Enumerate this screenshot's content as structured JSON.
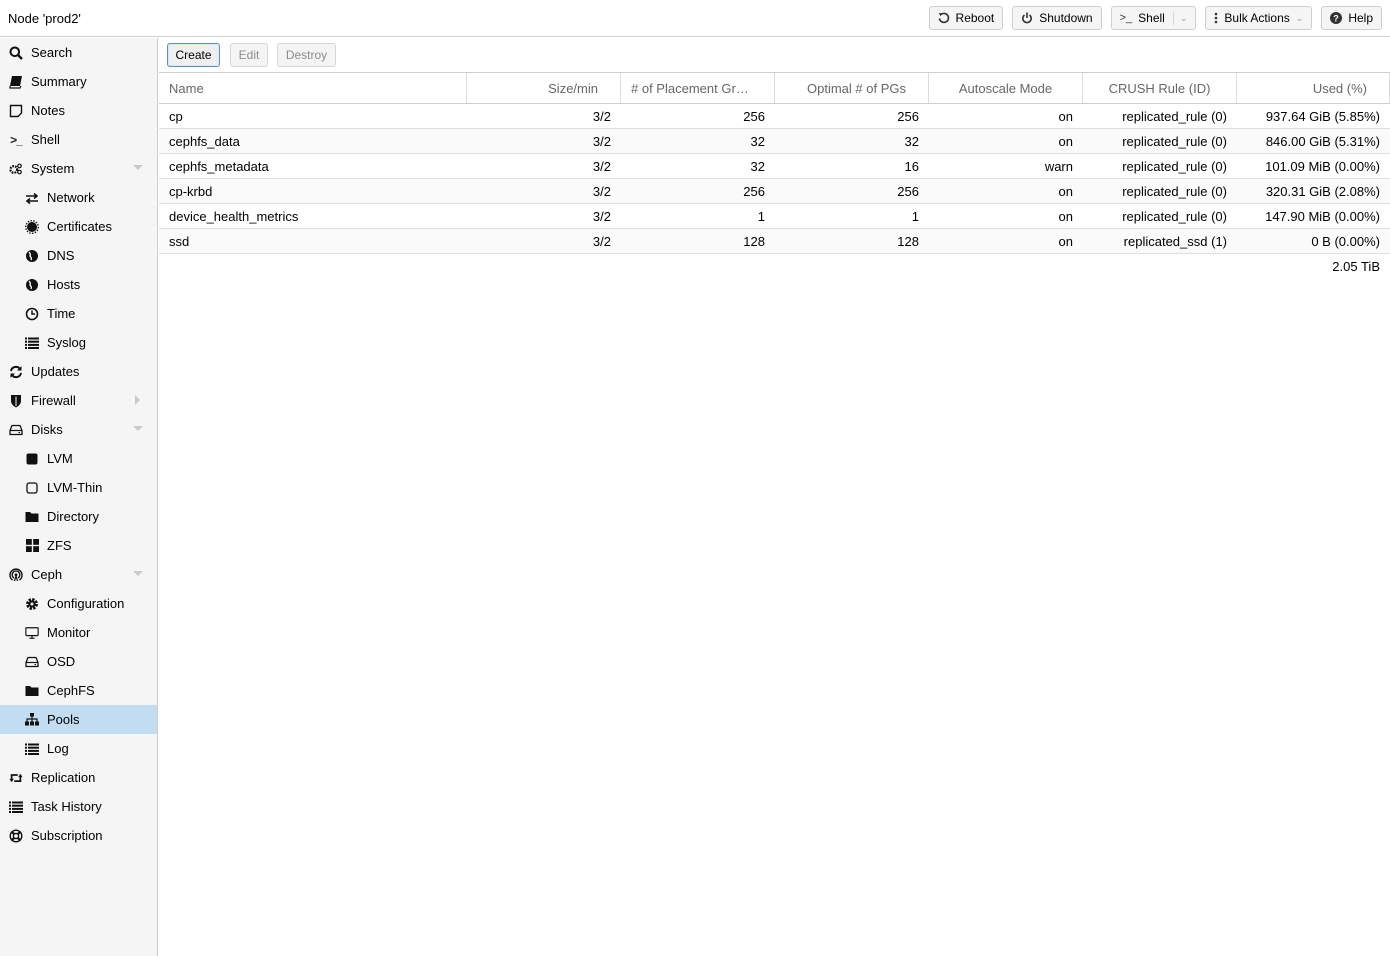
{
  "topbar": {
    "title": "Node 'prod2'",
    "buttons": {
      "reboot": "Reboot",
      "shutdown": "Shutdown",
      "shell": "Shell",
      "bulk_actions": "Bulk Actions",
      "help": "Help"
    }
  },
  "sidebar": {
    "items": [
      {
        "label": "Search",
        "icon": "search-icon",
        "level": 1
      },
      {
        "label": "Summary",
        "icon": "book-icon",
        "level": 1
      },
      {
        "label": "Notes",
        "icon": "sticky-note-icon",
        "level": 1
      },
      {
        "label": "Shell",
        "icon": "terminal-icon",
        "level": 1
      },
      {
        "label": "System",
        "icon": "gears-icon",
        "level": 1,
        "expander": "expanded"
      },
      {
        "label": "Network",
        "icon": "exchange-icon",
        "level": 2
      },
      {
        "label": "Certificates",
        "icon": "certificate-icon",
        "level": 2
      },
      {
        "label": "DNS",
        "icon": "globe-icon",
        "level": 2
      },
      {
        "label": "Hosts",
        "icon": "globe-icon",
        "level": 2
      },
      {
        "label": "Time",
        "icon": "clock-icon",
        "level": 2
      },
      {
        "label": "Syslog",
        "icon": "list-icon",
        "level": 2
      },
      {
        "label": "Updates",
        "icon": "refresh-icon",
        "level": 1
      },
      {
        "label": "Firewall",
        "icon": "shield-icon",
        "level": 1,
        "expander": "collapsed"
      },
      {
        "label": "Disks",
        "icon": "hdd-icon",
        "level": 1,
        "expander": "expanded"
      },
      {
        "label": "LVM",
        "icon": "square-icon",
        "level": 2
      },
      {
        "label": "LVM-Thin",
        "icon": "square-outline-icon",
        "level": 2
      },
      {
        "label": "Directory",
        "icon": "folder-icon",
        "level": 2
      },
      {
        "label": "ZFS",
        "icon": "th-large-icon",
        "level": 2
      },
      {
        "label": "Ceph",
        "icon": "ceph-icon",
        "level": 1,
        "expander": "expanded"
      },
      {
        "label": "Configuration",
        "icon": "gear-icon",
        "level": 2
      },
      {
        "label": "Monitor",
        "icon": "desktop-icon",
        "level": 2
      },
      {
        "label": "OSD",
        "icon": "hdd-icon",
        "level": 2
      },
      {
        "label": "CephFS",
        "icon": "folder-icon",
        "level": 2
      },
      {
        "label": "Pools",
        "icon": "sitemap-icon",
        "level": 2,
        "selected": true
      },
      {
        "label": "Log",
        "icon": "list-icon",
        "level": 2
      },
      {
        "label": "Replication",
        "icon": "retweet-icon",
        "level": 1
      },
      {
        "label": "Task History",
        "icon": "list-icon",
        "level": 1
      },
      {
        "label": "Subscription",
        "icon": "support-icon",
        "level": 1
      }
    ]
  },
  "toolbar": {
    "create": "Create",
    "edit": "Edit",
    "destroy": "Destroy"
  },
  "grid": {
    "columns": [
      "Name",
      "Size/min",
      "# of Placement Gr…",
      "Optimal # of PGs",
      "Autoscale Mode",
      "CRUSH Rule (ID)",
      "Used (%)"
    ],
    "rows": [
      [
        "cp",
        "3/2",
        "256",
        "256",
        "on",
        "replicated_rule (0)",
        "937.64 GiB (5.85%)"
      ],
      [
        "cephfs_data",
        "3/2",
        "32",
        "32",
        "on",
        "replicated_rule (0)",
        "846.00 GiB (5.31%)"
      ],
      [
        "cephfs_metadata",
        "3/2",
        "32",
        "16",
        "warn",
        "replicated_rule (0)",
        "101.09 MiB (0.00%)"
      ],
      [
        "cp-krbd",
        "3/2",
        "256",
        "256",
        "on",
        "replicated_rule (0)",
        "320.31 GiB (2.08%)"
      ],
      [
        "device_health_metrics",
        "3/2",
        "1",
        "1",
        "on",
        "replicated_rule (0)",
        "147.90 MiB (0.00%)"
      ],
      [
        "ssd",
        "3/2",
        "128",
        "128",
        "on",
        "replicated_ssd (1)",
        "0 B (0.00%)"
      ]
    ],
    "summary_used": "2.05 TiB"
  },
  "colors": {
    "selected_bg": "#c2ddf2",
    "sidebar_bg": "#f5f5f5",
    "border": "#cfcfcf"
  }
}
